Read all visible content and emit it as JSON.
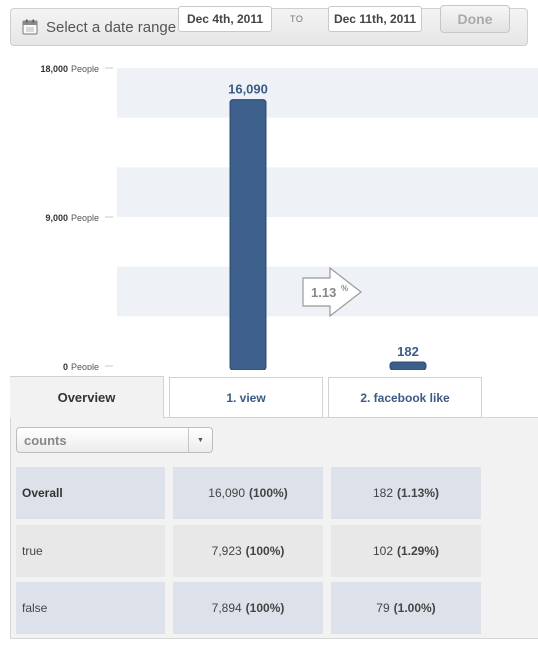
{
  "date_range": {
    "label": "Select a date range",
    "from": "Dec 4th, 2011",
    "to_label": "TO",
    "to": "Dec 11th, 2011",
    "done_label": "Done"
  },
  "chart_data": {
    "type": "bar",
    "categories": [
      "1. view",
      "2. facebook like"
    ],
    "values": [
      16090,
      182
    ],
    "data_labels": [
      "16,090",
      "182"
    ],
    "ylim": [
      0,
      18000
    ],
    "yticks": [
      {
        "value": 0,
        "label": "0",
        "unit": "People"
      },
      {
        "value": 9000,
        "label": "9,000",
        "unit": "People"
      },
      {
        "value": 18000,
        "label": "18,000",
        "unit": "People"
      }
    ],
    "conversion": {
      "value": "1.13",
      "unit": "%"
    },
    "bar_color": "#3d5f8c",
    "band_color": "#eef1f6"
  },
  "tabs": [
    {
      "label": "Overview",
      "active": true
    },
    {
      "label": "1. view",
      "active": false
    },
    {
      "label": "2. facebook like",
      "active": false
    }
  ],
  "metric_select": {
    "value": "counts"
  },
  "table": {
    "rows": [
      {
        "label": "Overall",
        "v1": "16,090",
        "v1_pct": "(100%)",
        "v2": "182",
        "v2_pct": "(1.13%)"
      },
      {
        "label": "true",
        "v1": "7,923",
        "v1_pct": "(100%)",
        "v2": "102",
        "v2_pct": "(1.29%)"
      },
      {
        "label": "false",
        "v1": "7,894",
        "v1_pct": "(100%)",
        "v2": "79",
        "v2_pct": "(1.00%)"
      }
    ]
  }
}
